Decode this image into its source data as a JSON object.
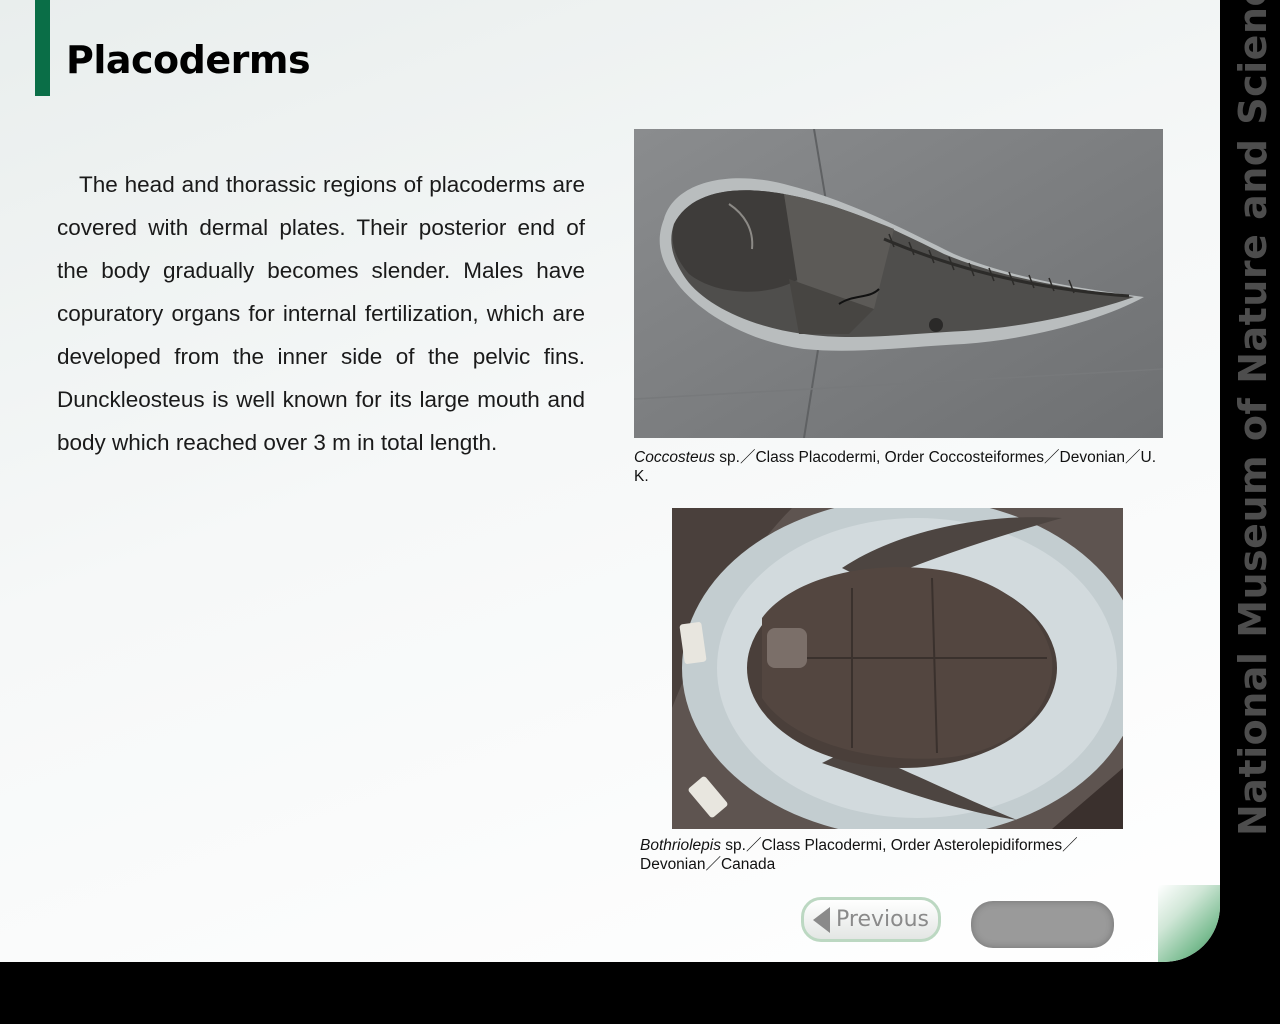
{
  "page": {
    "title": "Placoderms",
    "body": "The head and thorassic regions of placoderms are covered with dermal plates. Their posterior end of the body gradually becomes slender. Males have copuratory organs for internal fertilization, which are developed from the inner side of the pelvic fins. Dunckleosteus is well known for its large mouth and body which reached over  3 m in total length."
  },
  "figures": [
    {
      "species": "Coccosteus",
      "caption_rest": " sp.／Class Placodermi, Order Coccosteiformes／Devonian／U. K."
    },
    {
      "species": "Bothriolepis",
      "caption_rest": " sp.／Class Placodermi, Order Asterolepidiformes／Devonian／Canada"
    }
  ],
  "nav": {
    "previous_label": "Previous"
  },
  "side_banner": "National Museum of Nature and Science",
  "colors": {
    "accent": "#0a6e47",
    "banner_text": "#4d4d4d"
  }
}
